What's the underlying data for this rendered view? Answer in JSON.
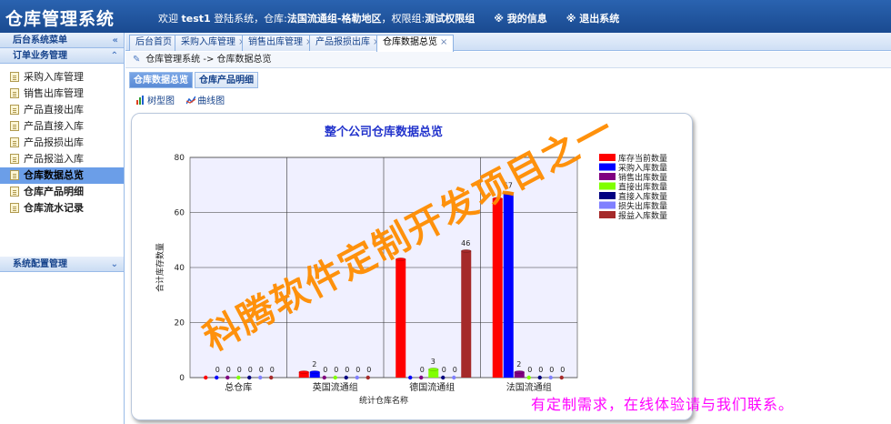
{
  "header": {
    "title": "仓库管理系统",
    "welcome": "欢迎",
    "username": "test1",
    "login_text": "登陆系统，仓库:",
    "warehouse": "法国流通组-格勒地区",
    "perm_label": "，权限组:",
    "perm_group": "测试权限组",
    "my_info": "※ 我的信息",
    "logout": "※ 退出系统"
  },
  "sidebar": {
    "backend_menu": "后台系统菜单",
    "backend_toggle": "«",
    "order_section": "订单业务管理",
    "order_toggle": "⌃",
    "items": [
      {
        "label": "采购入库管理"
      },
      {
        "label": "销售出库管理"
      },
      {
        "label": "产品直接出库"
      },
      {
        "label": "产品直接入库"
      },
      {
        "label": "产品报损出库"
      },
      {
        "label": "产品报溢入库"
      },
      {
        "label": "仓库数据总览"
      },
      {
        "label": "仓库产品明细"
      },
      {
        "label": "仓库流水记录"
      }
    ],
    "config_section": "系统配置管理",
    "config_toggle": "⌄"
  },
  "tabs": [
    {
      "label": "后台首页",
      "close": ""
    },
    {
      "label": "采购入库管理",
      "close": "×"
    },
    {
      "label": "销售出库管理",
      "close": "×"
    },
    {
      "label": "产品报损出库",
      "close": "×"
    },
    {
      "label": "仓库数据总览",
      "close": "×"
    }
  ],
  "breadcrumb": "仓库管理系统 -> 仓库数据总览",
  "subtabs": [
    "仓库数据总览",
    "仓库产品明细"
  ],
  "toolbar": {
    "bar_chart": "树型图",
    "line_chart": "曲线图"
  },
  "chart_data": {
    "type": "bar",
    "title": "整个公司仓库数据总览",
    "xlabel": "统计仓库名称",
    "ylabel": "合计库存数量",
    "ylim": [
      0,
      80
    ],
    "yticks": [
      0,
      20,
      40,
      60,
      80
    ],
    "grid": true,
    "legend_position": "right",
    "categories": [
      "总仓库",
      "英国流通组",
      "德国流通组",
      "法国流通组"
    ],
    "series": [
      {
        "name": "库存当前数量",
        "color": "#ff0000",
        "values": [
          0,
          2,
          43,
          65
        ]
      },
      {
        "name": "采购入库数量",
        "color": "#0000ff",
        "values": [
          0,
          2,
          0,
          67
        ]
      },
      {
        "name": "销售出库数量",
        "color": "#800080",
        "values": [
          0,
          0,
          0,
          2
        ]
      },
      {
        "name": "直接出库数量",
        "color": "#80ff00",
        "values": [
          0,
          0,
          3,
          0
        ]
      },
      {
        "name": "直接入库数量",
        "color": "#000080",
        "values": [
          0,
          0,
          0,
          0
        ]
      },
      {
        "name": "损失出库数量",
        "color": "#8080ff",
        "values": [
          0,
          0,
          0,
          0
        ]
      },
      {
        "name": "报益入库数量",
        "color": "#a52a2a",
        "values": [
          0,
          0,
          46,
          0
        ]
      }
    ],
    "data_labels": [
      [
        "",
        "0",
        "0",
        "0",
        "0",
        "0",
        "0"
      ],
      [
        "",
        "2",
        "0",
        "0",
        "0",
        "0",
        "0"
      ],
      [
        "",
        "",
        "0",
        "3",
        "0",
        "0",
        "46"
      ],
      [
        "",
        "67",
        "2",
        "0",
        "0",
        "0",
        "0"
      ]
    ]
  },
  "watermark": "科腾软件定制开发项目之一",
  "contact": "有定制需求，在线体验请与我们联系。"
}
